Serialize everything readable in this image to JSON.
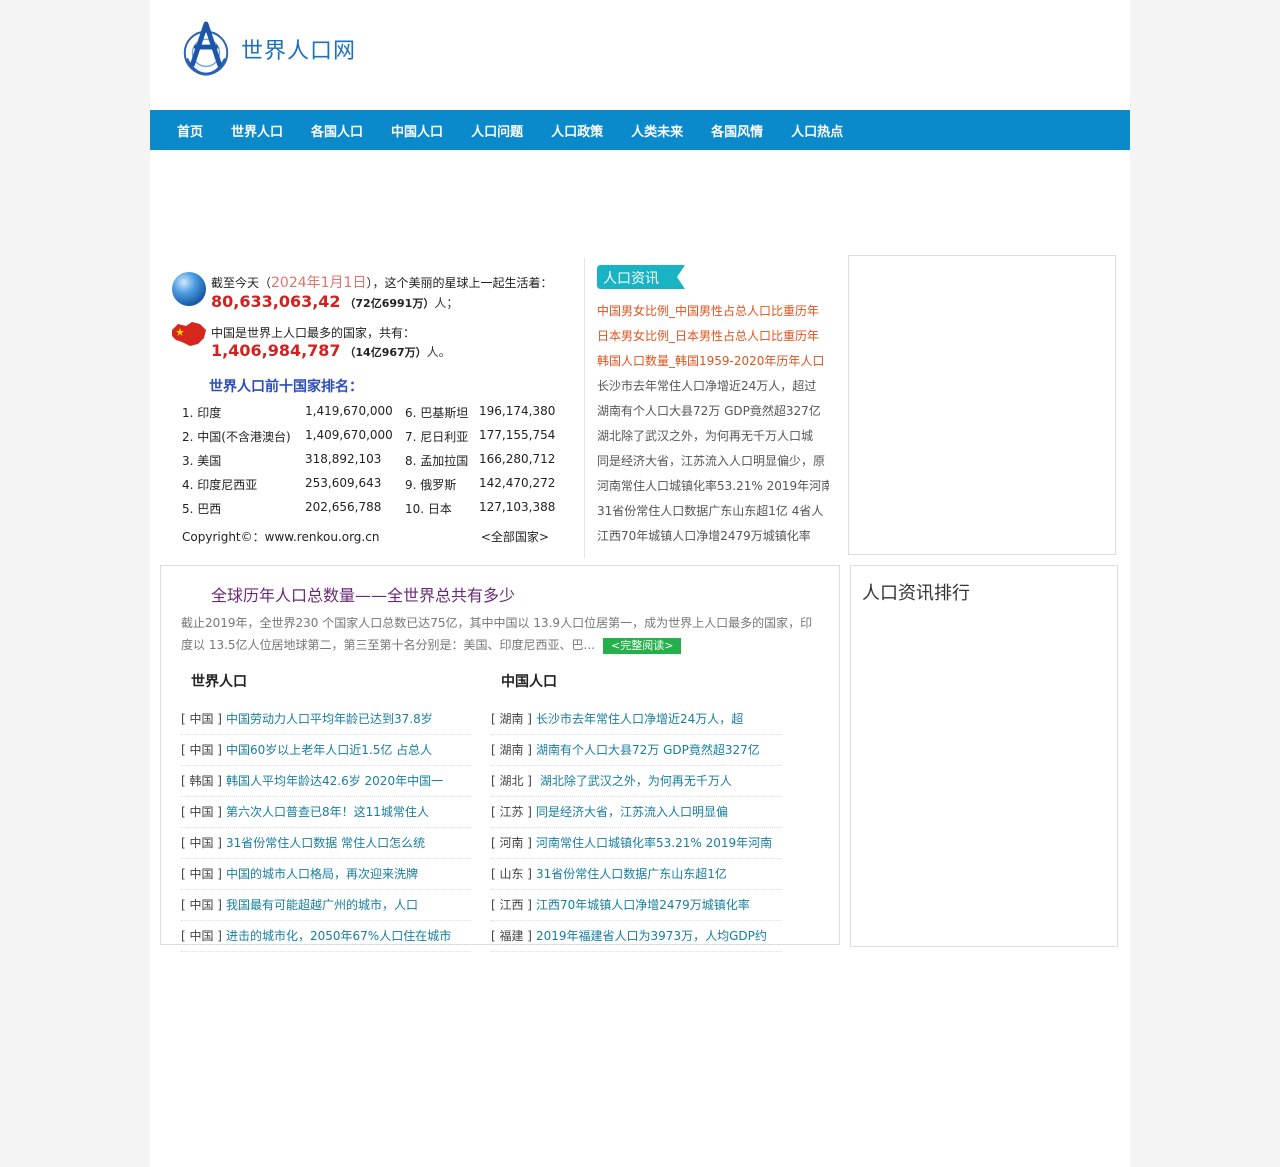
{
  "site": {
    "name": "世界人口网"
  },
  "nav": [
    "首页",
    "世界人口",
    "各国人口",
    "中国人口",
    "人口问题",
    "人口政策",
    "人类未来",
    "各国风情",
    "人口热点"
  ],
  "counter": {
    "world_prefix": "截至今天（",
    "world_date": "2024年1月1日",
    "world_suffix": "），这个美丽的星球上一起生活着：",
    "world_number": "80,633,063,42",
    "world_short": "（72亿6991万）",
    "world_unit": "人；",
    "china_intro": "中国是世界上人口最多的国家，共有：",
    "china_number": "1,406,984,787",
    "china_short": "（14亿967万）",
    "china_unit": "人。"
  },
  "ranking": {
    "title": "世界人口前十国家排名：",
    "rows": [
      [
        "1. 印度",
        "1,419,670,000",
        "6. 巴基斯坦",
        "196,174,380"
      ],
      [
        "2. 中国(不含港澳台)",
        "1,409,670,000",
        "7. 尼日利亚",
        "177,155,754"
      ],
      [
        "3. 美国",
        "318,892,103",
        "8. 孟加拉国",
        "166,280,712"
      ],
      [
        "4. 印度尼西亚",
        "253,609,643",
        "9. 俄罗斯",
        "142,470,272"
      ],
      [
        "5. 巴西",
        "202,656,788",
        "10. 日本",
        "127,103,388"
      ]
    ],
    "copyright": "Copyright©：www.renkou.org.cn",
    "more": "<全部国家>"
  },
  "news": {
    "tag": "人口资讯",
    "items": [
      "中国男女比例_中国男性占总人口比重历年",
      "日本男女比例_日本男性占总人口比重历年",
      "韩国人口数量_韩国1959-2020年历年人口",
      "长沙市去年常住人口净增近24万人，超过",
      "湖南有个人口大县72万 GDP竟然超327亿",
      "湖北除了武汉之外，为何再无千万人口城",
      "同是经济大省，江苏流入人口明显偏少，原",
      "河南常住人口城镇化率53.21% 2019年河南",
      "31省份常住人口数据广东山东超1亿 4省人",
      "江西70年城镇人口净增2479万城镇化率"
    ]
  },
  "article": {
    "title": "全球历年人口总数量——全世界总共有多少",
    "summary": "截止2019年，全世界230 个国家人口总数已达75亿，其中中国以 13.9人口位居第一，成为世界上人口最多的国家，印度以 13.5亿人位居地球第二，第三至第十名分别是：美国、印度尼西亚、巴...",
    "read_more": "<完整阅读>"
  },
  "world_col": {
    "title": "世界人口",
    "items": [
      {
        "region": "[ 中国 ]",
        "text": "中国劳动力人口平均年龄已达到37.8岁"
      },
      {
        "region": "[ 中国 ]",
        "text": "中国60岁以上老年人口近1.5亿 占总人"
      },
      {
        "region": "[ 韩国 ]",
        "text": "韩国人平均年龄达42.6岁 2020年中国一"
      },
      {
        "region": "[ 中国 ]",
        "text": "第六次人口普查已8年！这11城常住人"
      },
      {
        "region": "[ 中国 ]",
        "text": "31省份常住人口数据 常住人口怎么统"
      },
      {
        "region": "[ 中国 ]",
        "text": "中国的城市人口格局，再次迎来洗牌"
      },
      {
        "region": "[ 中国 ]",
        "text": "我国最有可能超越广州的城市，人口"
      },
      {
        "region": "[ 中国 ]",
        "text": "进击的城市化，2050年67%人口住在城市"
      }
    ]
  },
  "china_col": {
    "title": "中国人口",
    "items": [
      {
        "region": "[ 湖南 ]",
        "text": "长沙市去年常住人口净增近24万人，超"
      },
      {
        "region": "[ 湖南 ]",
        "text": "湖南有个人口大县72万 GDP竟然超327亿"
      },
      {
        "region": "[ 湖北 ]",
        "text": " 湖北除了武汉之外，为何再无千万人"
      },
      {
        "region": "[ 江苏 ]",
        "text": "同是经济大省，江苏流入人口明显偏"
      },
      {
        "region": "[ 河南 ]",
        "text": "河南常住人口城镇化率53.21% 2019年河南"
      },
      {
        "region": "[ 山东 ]",
        "text": "31省份常住人口数据广东山东超1亿"
      },
      {
        "region": "[ 江西 ]",
        "text": "江西70年城镇人口净增2479万城镇化率"
      },
      {
        "region": "[ 福建 ]",
        "text": "2019年福建省人口为3973万，人均GDP约"
      }
    ]
  },
  "rank_box": {
    "title": "人口资讯排行"
  },
  "colors": {
    "nav": "#0a8acb",
    "accent_red": "#d4201e",
    "link_teal": "#167ea0",
    "hot_orange": "#e0531c",
    "read_green": "#24b04a",
    "tag_teal": "#19b4c4"
  }
}
